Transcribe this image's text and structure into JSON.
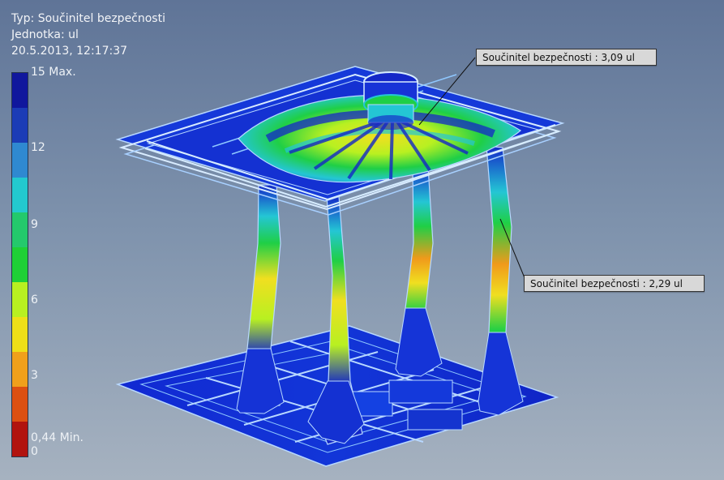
{
  "header": {
    "type_label": "Typ: Součinitel bezpečnosti",
    "unit_label": "Jednotka: ul",
    "timestamp": "20.5.2013, 12:17:37"
  },
  "legend": {
    "ticks": [
      {
        "value": 15,
        "label": "15 Max."
      },
      {
        "value": 12,
        "label": "12"
      },
      {
        "value": 9,
        "label": "9"
      },
      {
        "value": 6,
        "label": "6"
      },
      {
        "value": 3,
        "label": "3"
      },
      {
        "value": 0.44,
        "label": "0,44 Min."
      },
      {
        "value": 0,
        "label": "0"
      }
    ],
    "colors": [
      "#10179d",
      "#1b3cb6",
      "#2f89d1",
      "#23c9cf",
      "#24c96c",
      "#1fd036",
      "#b8f021",
      "#eedf18",
      "#f0a01b",
      "#dc5012",
      "#b1130f"
    ]
  },
  "annotations": [
    {
      "text": "Součinitel bezpečnosti : 3,09 ul"
    },
    {
      "text": "Součinitel bezpečnosti : 2,29 ul"
    }
  ],
  "colors": {
    "background_top": "#5f7497",
    "background_bottom": "#a6b2c0",
    "mesh_outline": "#b8d8ff",
    "safe_blue": "#1427c8",
    "stress_green": "#1fcf46",
    "stress_yellow": "#f0df20",
    "stress_orange": "#f09a1b",
    "stress_cyan": "#24c6d4"
  }
}
